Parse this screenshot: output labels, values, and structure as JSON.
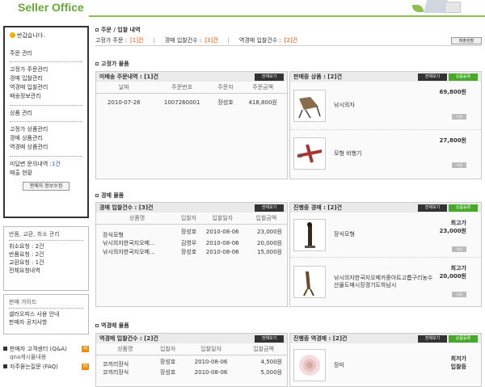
{
  "header": {
    "brand": "Seller Office"
  },
  "left": {
    "greeting": "반갑습니다.",
    "order_mgmt_title": "주문 관리",
    "order_items": [
      "고정가 주문관리",
      "경매 입찰관리",
      "역경매 입찰관리",
      "배송정보관리"
    ],
    "product_mgmt_title": "상품 관리",
    "product_items": [
      "고정가 상품관리",
      "경매 상품관리",
      "역경매 상품관리"
    ],
    "inquiry_label": "미답변 문의내역 :",
    "inquiry_count": "1건",
    "sales_status": "매출 현황",
    "seller_info_btn": "판매자 정보수정"
  },
  "returns": {
    "title": "반품, 교환, 취소 관리",
    "items": [
      "취소요청 : 2건",
      "반품요청 : 2건",
      "교환요청 : 1건",
      "전체요청내역"
    ]
  },
  "guide": {
    "title": "판매 가이드",
    "items": [
      "셀러오피스 사용 안내",
      "판매자 공지사항"
    ]
  },
  "help": {
    "center": "판매자 고객센터 (Q&A)",
    "qna": "qna게시물내용",
    "faq": "자주묻는질문 (FAQ)",
    "badge": "M"
  },
  "main": {
    "title": "주문 / 입찰 내역",
    "fixed_label": "고정가 주문 :",
    "fixed_count": "[1]건",
    "auction_label": "경매 입찰건수 :",
    "auction_count": "[3]건",
    "reverse_label": "역경매 입찰건수 :",
    "reverse_count": "[2]건",
    "sales_btn": "매출현황"
  },
  "fixed": {
    "section": "고정가 물품",
    "orders_title": "미배송 주문내역 : [1]건",
    "view_all": "전체보기",
    "columns": [
      "날짜",
      "주문번호",
      "주문자",
      "주문금액"
    ],
    "rows": [
      [
        "2010-07-26",
        "1007260001",
        "장성호",
        "418,800원"
      ]
    ],
    "sale_title": "판매중 상품 : [2]건",
    "register": "상품등록",
    "products": [
      {
        "name": "낚시의자",
        "price": "69,800원",
        "btn": "수정"
      },
      {
        "name": "모형 비행기",
        "price": "27,800원",
        "btn": "수정"
      }
    ]
  },
  "auction": {
    "section": "경매 물품",
    "bids_title": "경매 입찰건수 : [3]건",
    "view_all": "전체보기",
    "columns": [
      "상품명",
      "입찰자",
      "입찰일자",
      "입찰금액"
    ],
    "rows": [
      [
        "장식모형",
        "장성호",
        "2010-08-06",
        "23,000원"
      ],
      [
        "낚시의자한국지오메...",
        "김영우",
        "2010-08-06",
        "20,000원"
      ],
      [
        "낚시의자한국지오메...",
        "장성호",
        "2010-08-06",
        "15,000원"
      ]
    ],
    "progress_title": "진행중 경매 : [2]건",
    "register": "상품등록",
    "products": [
      {
        "name": "장식모형",
        "price_label": "최고가",
        "price": "23,000원",
        "btn": "수정"
      },
      {
        "name": "낚시의자한국지오메카중아트고릅구리농수산물도매시장경기도하남시",
        "price_label": "최고가",
        "price": "20,000원",
        "btn": "수정"
      }
    ]
  },
  "reverse": {
    "section": "역경매 물품",
    "bids_title": "역경매 입찰건수 : [2]건",
    "view_all": "전체보기",
    "columns": [
      "상품명",
      "입찰자",
      "입찰일자",
      "입찰금액"
    ],
    "rows": [
      [
        "코끼리장식",
        "장성호",
        "2010-08-06",
        "4,500원"
      ],
      [
        "코끼리장식",
        "장성호",
        "2010-08-06",
        "5,000원"
      ]
    ],
    "progress_title": "진행중 역경매 : [2]건",
    "register": "상품등록",
    "products": [
      {
        "name": "장미",
        "price_label": "최저가",
        "price": "입찰중",
        "btn": "수정"
      }
    ]
  }
}
